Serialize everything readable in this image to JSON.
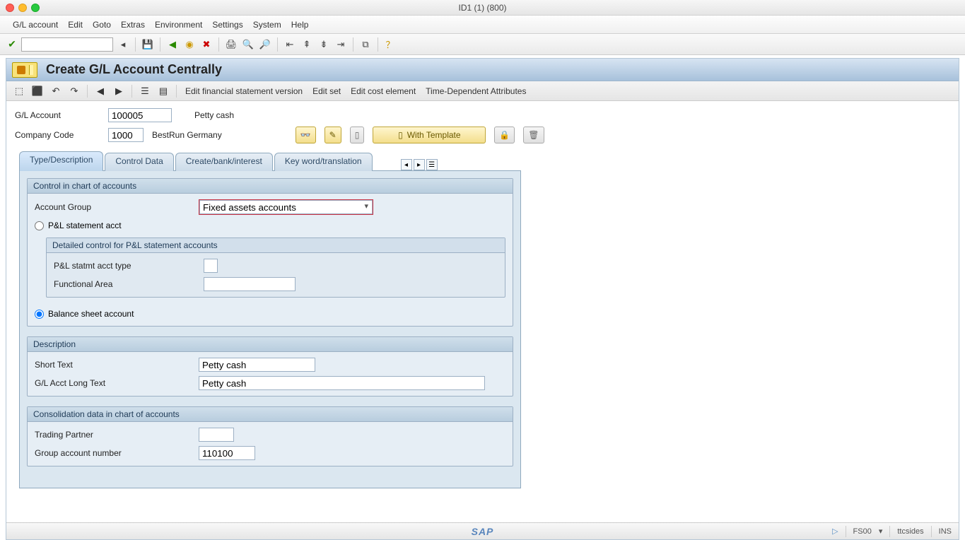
{
  "window": {
    "title": "ID1 (1) (800)"
  },
  "menubar": [
    "G/L account",
    "Edit",
    "Goto",
    "Extras",
    "Environment",
    "Settings",
    "System",
    "Help"
  ],
  "tx_title": "Create G/L Account Centrally",
  "app_toolbar": {
    "links": [
      "Edit financial statement version",
      "Edit set",
      "Edit cost element",
      "Time-Dependent Attributes"
    ]
  },
  "header": {
    "gl_account_label": "G/L Account",
    "gl_account_value": "100005",
    "gl_account_desc": "Petty cash",
    "company_code_label": "Company Code",
    "company_code_value": "1000",
    "company_code_desc": "BestRun Germany",
    "with_template_label": "With Template"
  },
  "tabs": [
    "Type/Description",
    "Control Data",
    "Create/bank/interest",
    "Key word/translation"
  ],
  "group1": {
    "title": "Control in chart of accounts",
    "account_group_label": "Account Group",
    "account_group_value": "Fixed assets accounts",
    "radio_pl": "P&L statement acct",
    "subgroup_title": "Detailed control for P&L statement accounts",
    "pl_type_label": "P&L statmt acct type",
    "func_area_label": "Functional Area",
    "radio_bs": "Balance sheet account"
  },
  "group2": {
    "title": "Description",
    "short_text_label": "Short Text",
    "short_text_value": "Petty cash",
    "long_text_label": "G/L Acct Long Text",
    "long_text_value": "Petty cash"
  },
  "group3": {
    "title": "Consolidation data in chart of accounts",
    "trading_partner_label": "Trading Partner",
    "group_account_label": "Group account number",
    "group_account_value": "110100"
  },
  "status": {
    "tcode": "FS00",
    "client": "ttcsides",
    "mode": "INS"
  }
}
